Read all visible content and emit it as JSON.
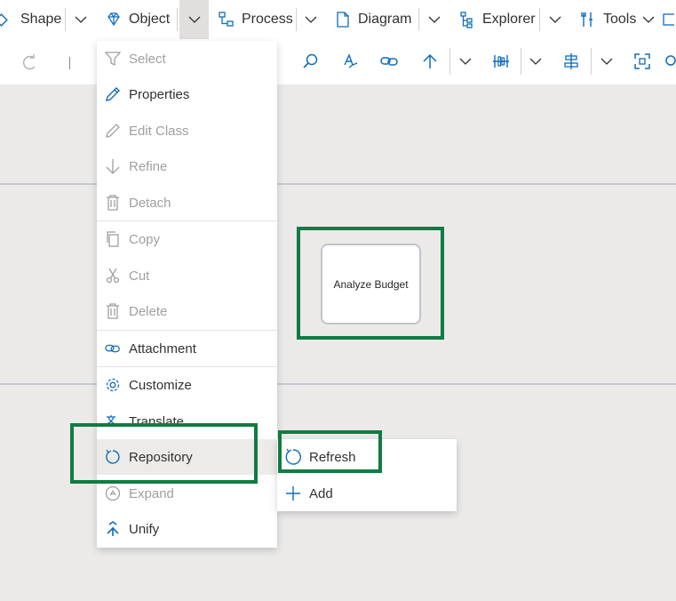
{
  "ribbon": {
    "items": [
      {
        "label": "Shape",
        "icon": "shape-icon"
      },
      {
        "label": "Object",
        "icon": "diamond-icon"
      },
      {
        "label": "Process",
        "icon": "process-icon"
      },
      {
        "label": "Diagram",
        "icon": "document-icon"
      },
      {
        "label": "Explorer",
        "icon": "tree-icon"
      },
      {
        "label": "Tools",
        "icon": "tools-icon"
      }
    ]
  },
  "canvas": {
    "shape_label": "Analyze Budget"
  },
  "menu": {
    "items": [
      {
        "label": "Select",
        "icon": "filter-icon",
        "enabled": false
      },
      {
        "label": "Properties",
        "icon": "pencil-icon",
        "enabled": true
      },
      {
        "label": "Edit Class",
        "icon": "pencil-icon",
        "enabled": false
      },
      {
        "label": "Refine",
        "icon": "arrow-down-icon",
        "enabled": false
      },
      {
        "label": "Detach",
        "icon": "trash-icon",
        "enabled": false
      },
      {
        "label": "Copy",
        "icon": "copy-icon",
        "enabled": false
      },
      {
        "label": "Cut",
        "icon": "scissors-icon",
        "enabled": false
      },
      {
        "label": "Delete",
        "icon": "trash-icon",
        "enabled": false
      },
      {
        "label": "Attachment",
        "icon": "link-icon",
        "enabled": true
      },
      {
        "label": "Customize",
        "icon": "gear-icon",
        "enabled": true
      },
      {
        "label": "Translate",
        "icon": "translate-icon",
        "enabled": true
      },
      {
        "label": "Repository",
        "icon": "refresh-icon",
        "enabled": true
      },
      {
        "label": "Expand",
        "icon": "expand-icon",
        "enabled": false
      },
      {
        "label": "Unify",
        "icon": "merge-icon",
        "enabled": true
      }
    ]
  },
  "submenu": {
    "items": [
      {
        "label": "Refresh",
        "icon": "refresh-icon"
      },
      {
        "label": "Add",
        "icon": "plus-icon"
      }
    ]
  },
  "colors": {
    "accent": "#0f6cbd",
    "highlight": "#107c41",
    "canvas": "#ebeae9"
  }
}
